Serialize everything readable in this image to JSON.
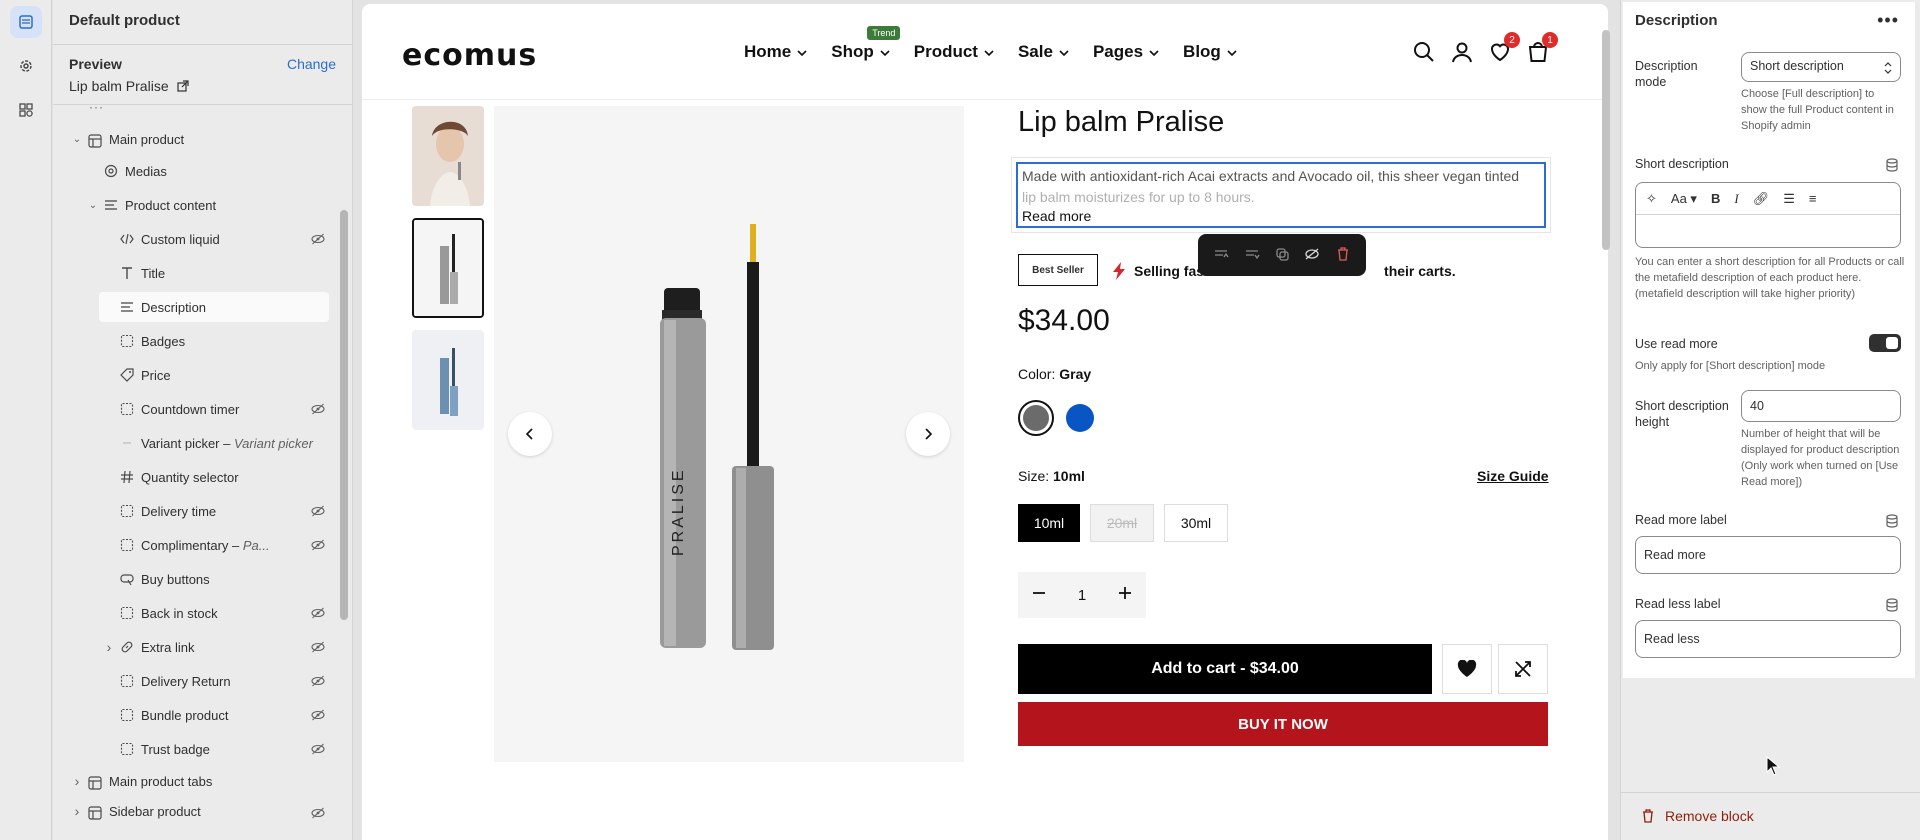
{
  "sidebar": {
    "title": "Default product",
    "preview_label": "Preview",
    "change_label": "Change",
    "preview_value": "Lip balm Pralise",
    "tree": [
      {
        "label": "Main product",
        "level": 1,
        "icon": "section-icon",
        "chevron": "open",
        "hidden": false
      },
      {
        "label": "Medias",
        "level": 2,
        "icon": "media-icon",
        "chevron": "",
        "hidden": false
      },
      {
        "label": "Product content",
        "level": 2,
        "icon": "text-icon",
        "chevron": "open",
        "hidden": false
      },
      {
        "label": "Custom liquid",
        "level": 3,
        "icon": "code-icon",
        "chevron": "",
        "hidden": true
      },
      {
        "label": "Title",
        "level": 3,
        "icon": "title-icon",
        "chevron": "",
        "hidden": false
      },
      {
        "label": "Description",
        "level": 3,
        "icon": "text-icon",
        "chevron": "",
        "hidden": false,
        "selected": true
      },
      {
        "label": "Badges",
        "level": 3,
        "icon": "block-icon",
        "chevron": "",
        "hidden": false
      },
      {
        "label": "Price",
        "level": 3,
        "icon": "price-icon",
        "chevron": "",
        "hidden": false
      },
      {
        "label": "Countdown timer",
        "level": 3,
        "icon": "block-icon",
        "chevron": "",
        "hidden": true
      },
      {
        "label": "Variant picker",
        "sub": "Variant picker",
        "level": 3,
        "icon": "none",
        "chevron": "",
        "hidden": false
      },
      {
        "label": "Quantity selector",
        "level": 3,
        "icon": "hash-icon",
        "chevron": "",
        "hidden": false
      },
      {
        "label": "Delivery time",
        "level": 3,
        "icon": "block-icon",
        "chevron": "",
        "hidden": true
      },
      {
        "label": "Complimentary",
        "sub": "Pa...",
        "level": 3,
        "icon": "block-icon",
        "chevron": "",
        "hidden": true
      },
      {
        "label": "Buy buttons",
        "level": 3,
        "icon": "buy-icon",
        "chevron": "",
        "hidden": false
      },
      {
        "label": "Back in stock",
        "level": 3,
        "icon": "block-icon",
        "chevron": "",
        "hidden": true
      },
      {
        "label": "Extra link",
        "level": 3,
        "icon": "link-icon",
        "chevron": "closed",
        "hidden": true
      },
      {
        "label": "Delivery Return",
        "level": 3,
        "icon": "block-icon",
        "chevron": "",
        "hidden": true
      },
      {
        "label": "Bundle product",
        "level": 3,
        "icon": "block-icon",
        "chevron": "",
        "hidden": true
      },
      {
        "label": "Trust badge",
        "level": 3,
        "icon": "block-icon",
        "chevron": "",
        "hidden": true
      },
      {
        "label": "Main product tabs",
        "level": 1,
        "icon": "section-icon",
        "chevron": "closed",
        "hidden": false
      },
      {
        "label": "Sidebar product",
        "level": 1,
        "icon": "section-icon",
        "chevron": "closed",
        "hidden": true
      }
    ]
  },
  "site": {
    "logo": "ecomus",
    "nav": [
      "Home",
      "Shop",
      "Product",
      "Sale",
      "Pages",
      "Blog"
    ],
    "trend_badge": "Trend",
    "wishlist_count": "2",
    "cart_count": "1"
  },
  "product": {
    "title": "Lip balm Pralise",
    "description_line1": "Made with antioxidant-rich Acai extracts and Avocado oil, this sheer vegan tinted",
    "description_line2": "lip balm moisturizes for up to 8 hours.",
    "read_more": "Read more",
    "image_text": "PRALISE",
    "best_seller": "Best Seller",
    "selling_fast_a": "Selling fas",
    "selling_fast_b": "their carts.",
    "price": "$34.00",
    "color_label": "Color:",
    "color_value": "Gray",
    "size_label": "Size:",
    "size_value": "10ml",
    "size_guide": "Size Guide",
    "sizes": [
      "10ml",
      "20ml",
      "30ml"
    ],
    "quantity": "1",
    "add_to_cart": "Add to cart - $34.00",
    "buy_now": "BUY IT NOW",
    "swatch_colors": [
      "#6b6b6b",
      "#0a55c4"
    ]
  },
  "panel": {
    "title": "Description",
    "desc_mode_label": "Description mode",
    "desc_mode_value": "Short description",
    "desc_mode_help": "Choose [Full description] to show the full Product content in Shopify admin",
    "short_desc_label": "Short description",
    "short_desc_help": "You can enter a short description for all Products or call the metafield description of each product here. (metafield description will take higher priority)",
    "use_read_more_label": "Use read more",
    "use_read_more_help": "Only apply for [Short description] mode",
    "short_height_label": "Short description height",
    "short_height_value": "40",
    "short_height_help": "Number of height that will be displayed for product description (Only work when turned on [Use Read more])",
    "read_more_label": "Read more label",
    "read_more_value": "Read more",
    "read_less_label": "Read less label",
    "read_less_value": "Read less",
    "remove_block": "Remove block"
  }
}
